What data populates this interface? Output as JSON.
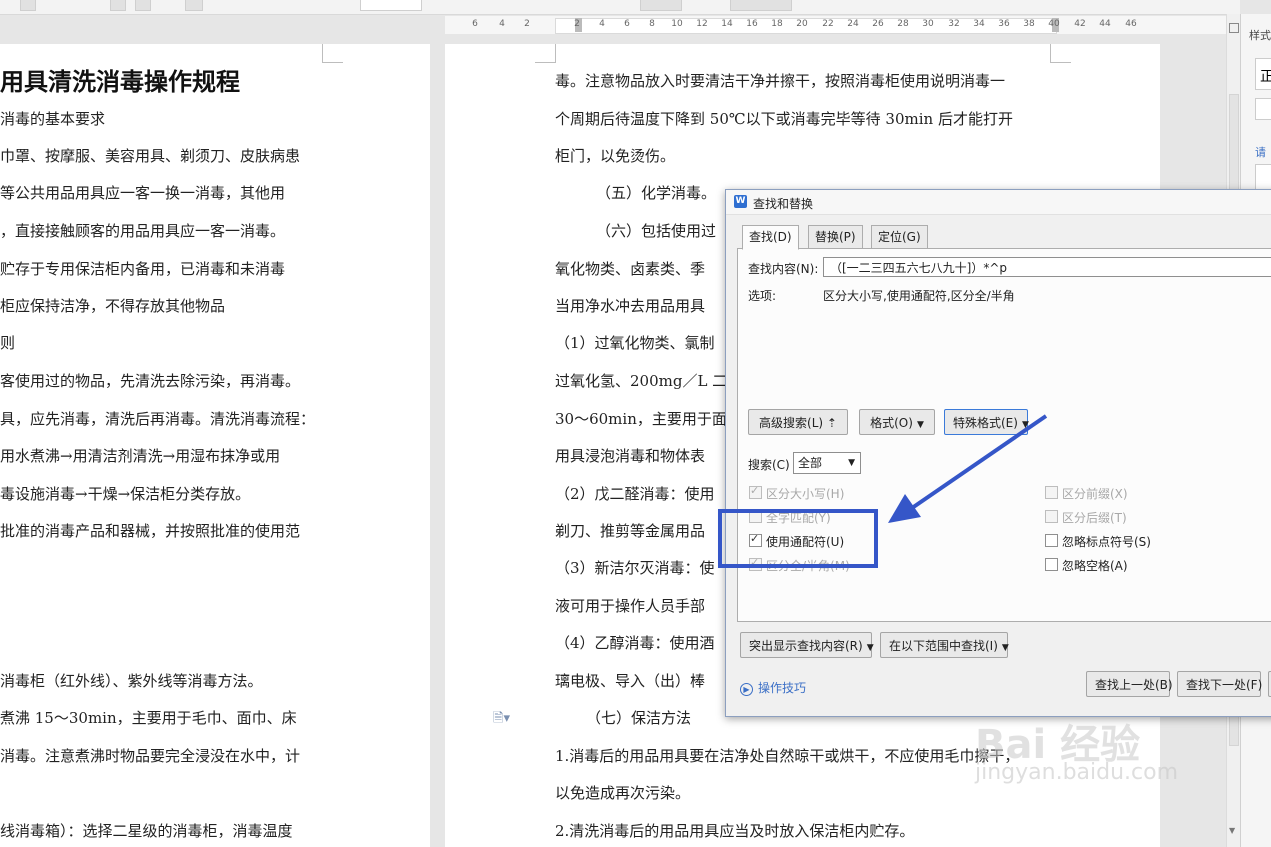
{
  "ruler": {
    "numbers": [
      "6",
      "4",
      "2",
      "2",
      "4",
      "6",
      "8",
      "10",
      "12",
      "14",
      "16",
      "18",
      "20",
      "22",
      "24",
      "26",
      "28",
      "30",
      "32",
      "34",
      "36",
      "38",
      "40",
      "42",
      "44",
      "46"
    ]
  },
  "left_page": {
    "title": "用具清洗消毒操作规程",
    "lines": [
      "消毒的基本要求",
      "巾罩、按摩服、美容用具、剃须刀、皮肤病患",
      "等公共用品用具应一客一换一消毒，其他用",
      "，直接接触顾客的用品用具应一客一消毒。",
      "贮存于专用保洁柜内备用，已消毒和未消毒",
      "柜应保持洁净，不得存放其他物品",
      "则",
      "客使用过的物品，先清洗去除污染，再消毒。",
      "具，应先消毒，清洗后再消毒。清洗消毒流程：",
      "用水煮沸→用清洁剂清洗→用湿布抹净或用",
      "毒设施消毒→干燥→保洁柜分类存放。",
      "批准的消毒产品和器械，并按照批准的使用范",
      "消毒柜（红外线）、紫外线等消毒方法。",
      "煮沸 15～30min，主要用于毛巾、面巾、床",
      "消毒。注意煮沸时物品要完全浸没在水中，计",
      "线消毒箱）：选择二星级的消毒柜，消毒温度"
    ]
  },
  "right_page": {
    "lines": [
      "毒。注意物品放入时要清洁干净并擦干，按照消毒柜使用说明消毒一",
      "个周期后待温度下降到 50℃以下或消毒完毕等待 30min 后才能打开",
      "柜门，以免烫伤。",
      "（五）化学消毒。",
      "（六）包括使用过",
      "氧化物类、卤素类、季",
      "当用净水冲去用品用具",
      "（1）过氧化物类、氯制",
      "过氧化氢、200mg／L 二",
      "30～60min，主要用于面",
      "用具浸泡消毒和物体表",
      "（2）戊二醛消毒：使用",
      "剃刀、推剪等金属用品",
      "（3）新洁尔灭消毒：使",
      "液可用于操作人员手部",
      "（4）乙醇消毒：使用酒",
      "璃电极、导入（出）棒",
      "（七）保洁方法",
      "1.消毒后的用品用具要在洁净处自然晾干或烘干，不应使用毛巾擦干，",
      "以免造成再次污染。",
      "2.清洗消毒后的用品用具应当及时放入保洁柜内贮存。"
    ]
  },
  "side_panel": {
    "label_style": "样式",
    "label_zheng": "正",
    "label_qing": "请"
  },
  "dialog": {
    "title": "查找和替换",
    "app_icon": "W",
    "tabs": [
      "查找(D)",
      "替换(P)",
      "定位(G)"
    ],
    "find_label": "查找内容(N):",
    "find_value": "（[一二三四五六七八九十]）*^p",
    "options_label": "选项:",
    "options_value": "区分大小写,使用通配符,区分全/半角",
    "advanced_button": "高级搜索(L) ⇡",
    "format_button": "格式(O)",
    "special_button": "特殊格式(E)",
    "search_label": "搜索(C)",
    "search_value": "全部",
    "checkboxes_left": [
      {
        "label": "区分大小写(H)",
        "checked": true,
        "enabled": false
      },
      {
        "label": "全字匹配(Y)",
        "checked": false,
        "enabled": false
      },
      {
        "label": "使用通配符(U)",
        "checked": true,
        "enabled": true
      },
      {
        "label": "区分全/半角(M)",
        "checked": true,
        "enabled": false
      }
    ],
    "checkboxes_right": [
      {
        "label": "区分前缀(X)",
        "checked": false,
        "enabled": false
      },
      {
        "label": "区分后缀(T)",
        "checked": false,
        "enabled": false
      },
      {
        "label": "忽略标点符号(S)",
        "checked": false,
        "enabled": true
      },
      {
        "label": "忽略空格(A)",
        "checked": false,
        "enabled": true
      }
    ],
    "highlight_button": "突出显示查找内容(R)",
    "range_button": "在以下范围中查找(I)",
    "tips_link": "操作技巧",
    "find_prev_button": "查找上一处(B)",
    "find_next_button": "查找下一处(F)"
  },
  "annotation_color": "#3556c8",
  "watermark": {
    "text": "Bai 经验",
    "url": "jingyan.baidu.com"
  }
}
